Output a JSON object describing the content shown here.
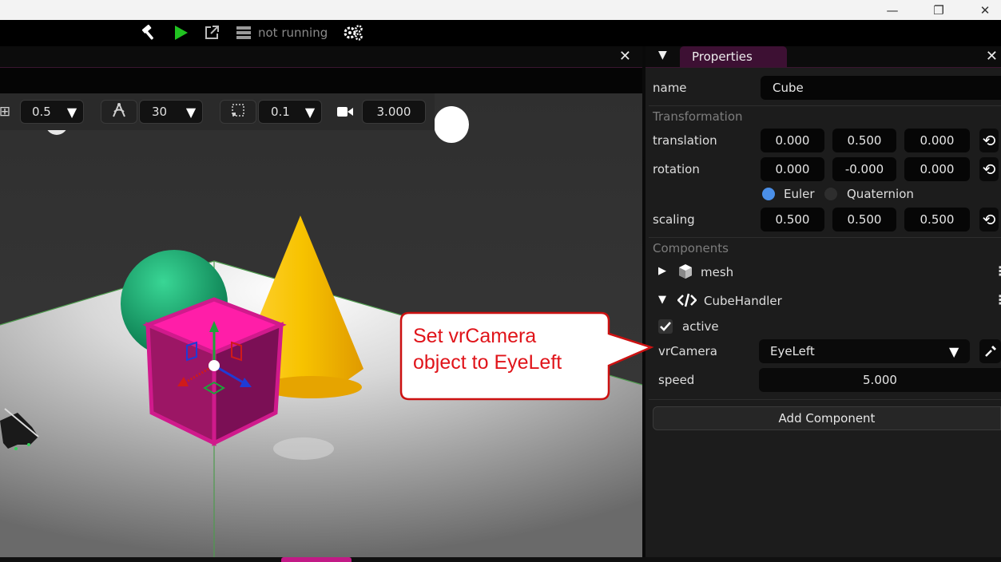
{
  "window": {
    "minimize": "—",
    "restore": "❐",
    "close": "✕"
  },
  "toolbar": {
    "build_icon": "hammer-icon",
    "play_icon": "play-icon",
    "external_icon": "external-link-icon",
    "server_icon": "server-icon",
    "status": "not running",
    "settings_icon": "gears-icon"
  },
  "viewport": {
    "close": "✕",
    "grid_snap": "0.5",
    "angle_snap": "30",
    "scale_snap": "0.1",
    "camera_speed": "3.000",
    "dropdown_glyph": "▼"
  },
  "properties": {
    "tab_label": "Properties",
    "close": "✕",
    "name_label": "name",
    "name_value": "Cube",
    "transformation_header": "Transformation",
    "translation_label": "translation",
    "translation": [
      "0.000",
      "0.500",
      "0.000"
    ],
    "rotation_label": "rotation",
    "rotation": [
      "0.000",
      "-0.000",
      "0.000"
    ],
    "euler_label": "Euler",
    "quaternion_label": "Quaternion",
    "rotation_mode": "Euler",
    "scaling_label": "scaling",
    "scaling": [
      "0.500",
      "0.500",
      "0.500"
    ],
    "components_header": "Components",
    "mesh_label": "mesh",
    "cubehandler_label": "CubeHandler",
    "active_label": "active",
    "active_checked": true,
    "vrcamera_label": "vrCamera",
    "vrcamera_value": "EyeLeft",
    "speed_label": "speed",
    "speed_value": "5.000",
    "add_component_label": "Add Component"
  },
  "callout": {
    "line1": "Set vrCamera",
    "line2": "object to EyeLeft"
  },
  "colors": {
    "accent": "#c21a86",
    "selected_cube": "#e0179a",
    "sphere": "#1fa070",
    "cone": "#f2b50a",
    "callout_red": "#e0141a",
    "radio_on": "#4a8fe8"
  }
}
